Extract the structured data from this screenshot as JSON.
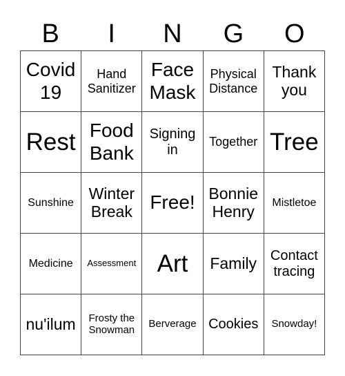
{
  "header": {
    "letters": [
      "B",
      "I",
      "N",
      "G",
      "O"
    ]
  },
  "grid": {
    "rows": [
      [
        "Covid 19",
        "Hand Sanitizer",
        "Face Mask",
        "Physical Distance",
        "Thank you"
      ],
      [
        "Rest",
        "Food Bank",
        "Signing in",
        "Together",
        "Tree"
      ],
      [
        "Sunshine",
        "Winter Break",
        "Free!",
        "Bonnie Henry",
        "Mistletoe"
      ],
      [
        "Medicine",
        "Assessment",
        "Art",
        "Family",
        "Contact tracing"
      ],
      [
        "nu'ilum",
        "Frosty the Snowman",
        "Berverage",
        "Cookies",
        "Snowday!"
      ]
    ]
  }
}
